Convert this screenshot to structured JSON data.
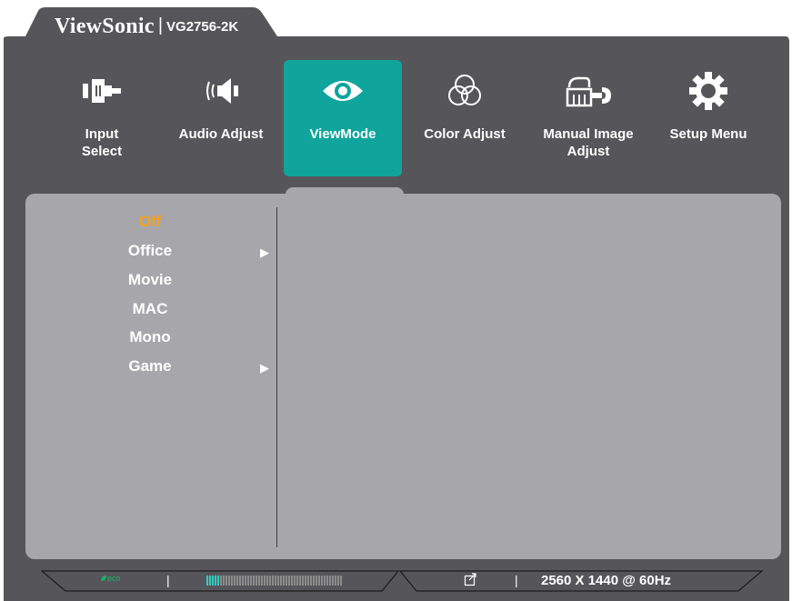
{
  "header": {
    "brand": "ViewSonic",
    "model": "VG2756-2K"
  },
  "tabs": [
    {
      "label": "Input\nSelect",
      "icon": "input-select-icon",
      "active": false
    },
    {
      "label": "Audio Adjust",
      "icon": "speaker-icon",
      "active": false
    },
    {
      "label": "ViewMode",
      "icon": "eye-icon",
      "active": true
    },
    {
      "label": "Color Adjust",
      "icon": "color-circles-icon",
      "active": false
    },
    {
      "label": "Manual Image\nAdjust",
      "icon": "hand-wrench-icon",
      "active": false
    },
    {
      "label": "Setup Menu",
      "icon": "gear-icon",
      "active": false
    }
  ],
  "menu": {
    "items": [
      {
        "label": "Off",
        "selected": true,
        "submenu": false
      },
      {
        "label": "Office",
        "selected": false,
        "submenu": true
      },
      {
        "label": "Movie",
        "selected": false,
        "submenu": false
      },
      {
        "label": "MAC",
        "selected": false,
        "submenu": false
      },
      {
        "label": "Mono",
        "selected": false,
        "submenu": false
      },
      {
        "label": "Game",
        "selected": false,
        "submenu": true
      }
    ],
    "arrow_glyph": "▶"
  },
  "status": {
    "eco_label": "eco",
    "separator": "|",
    "eco_meter_fraction": 0.1,
    "resolution": "2560 X 1440 @ 60Hz"
  },
  "colors": {
    "frame": "#56565a",
    "accent": "#0fa59c",
    "panel": "#a7a7ab",
    "selected_text": "#f7a01a",
    "meter_on": "#2ecfc2"
  }
}
